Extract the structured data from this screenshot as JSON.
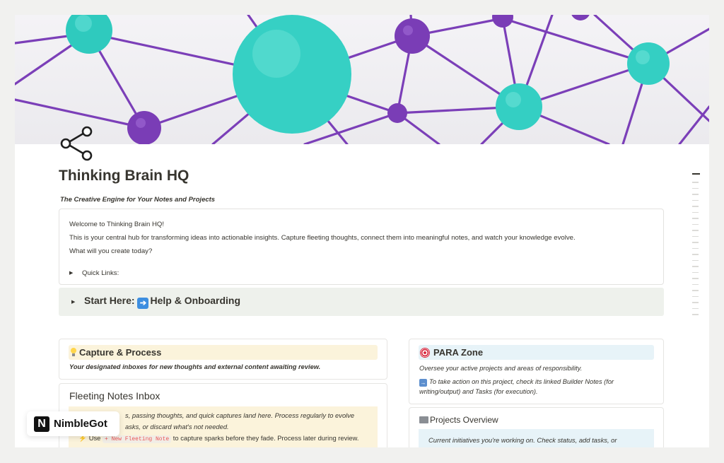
{
  "page": {
    "title": "Thinking Brain HQ",
    "subtitle": "The Creative Engine for Your Notes and Projects",
    "icon": "share-nodes-icon"
  },
  "cover": {
    "image": "network-of-teal-and-purple-spheres",
    "colors": {
      "teal": "#36d0c4",
      "purple": "#7b3fb8",
      "background": "#eeedf1"
    }
  },
  "welcome_callout": {
    "line1": "Welcome to Thinking Brain HQ!",
    "line2": "This is your central hub for transforming ideas into actionable insights. Capture fleeting thoughts, connect them into meaningful notes, and watch your knowledge evolve.",
    "line3": "What will you create today?",
    "quick_links_label": "Quick Links:"
  },
  "start_here": {
    "label_prefix": "Start Here: ",
    "label_suffix": "Help & Onboarding",
    "arrow_icon": "right-arrow-emoji-icon"
  },
  "capture_process": {
    "heading": "Capture & Process",
    "icon": "lightbulb-icon",
    "description": "Your designated inboxes for new thoughts and external content awaiting review."
  },
  "fleeting_notes": {
    "heading": "Fleeting Notes Inbox",
    "text_part1": "s, passing thoughts, and quick captures land here. Process regularly to evolve",
    "text_part2": "asks, or discard what's not needed.",
    "use_label": "Use",
    "button_code": "+ New Fleeting Note",
    "use_suffix": "to capture sparks before they fade. Process later during review."
  },
  "para_zone": {
    "heading": "PARA Zone",
    "icon": "target-icon",
    "description": "Oversee your active projects and areas of responsibility.",
    "note": "To take action on this project, check its linked Builder Notes (for writing/output) and Tasks (for execution)."
  },
  "projects_overview": {
    "heading": "Projects Overview",
    "icon": "folder-icon",
    "description": "Current initiatives you're working on. Check status, add tasks, or"
  },
  "watermark": {
    "letter": "N",
    "brand": "NimbleGot"
  }
}
